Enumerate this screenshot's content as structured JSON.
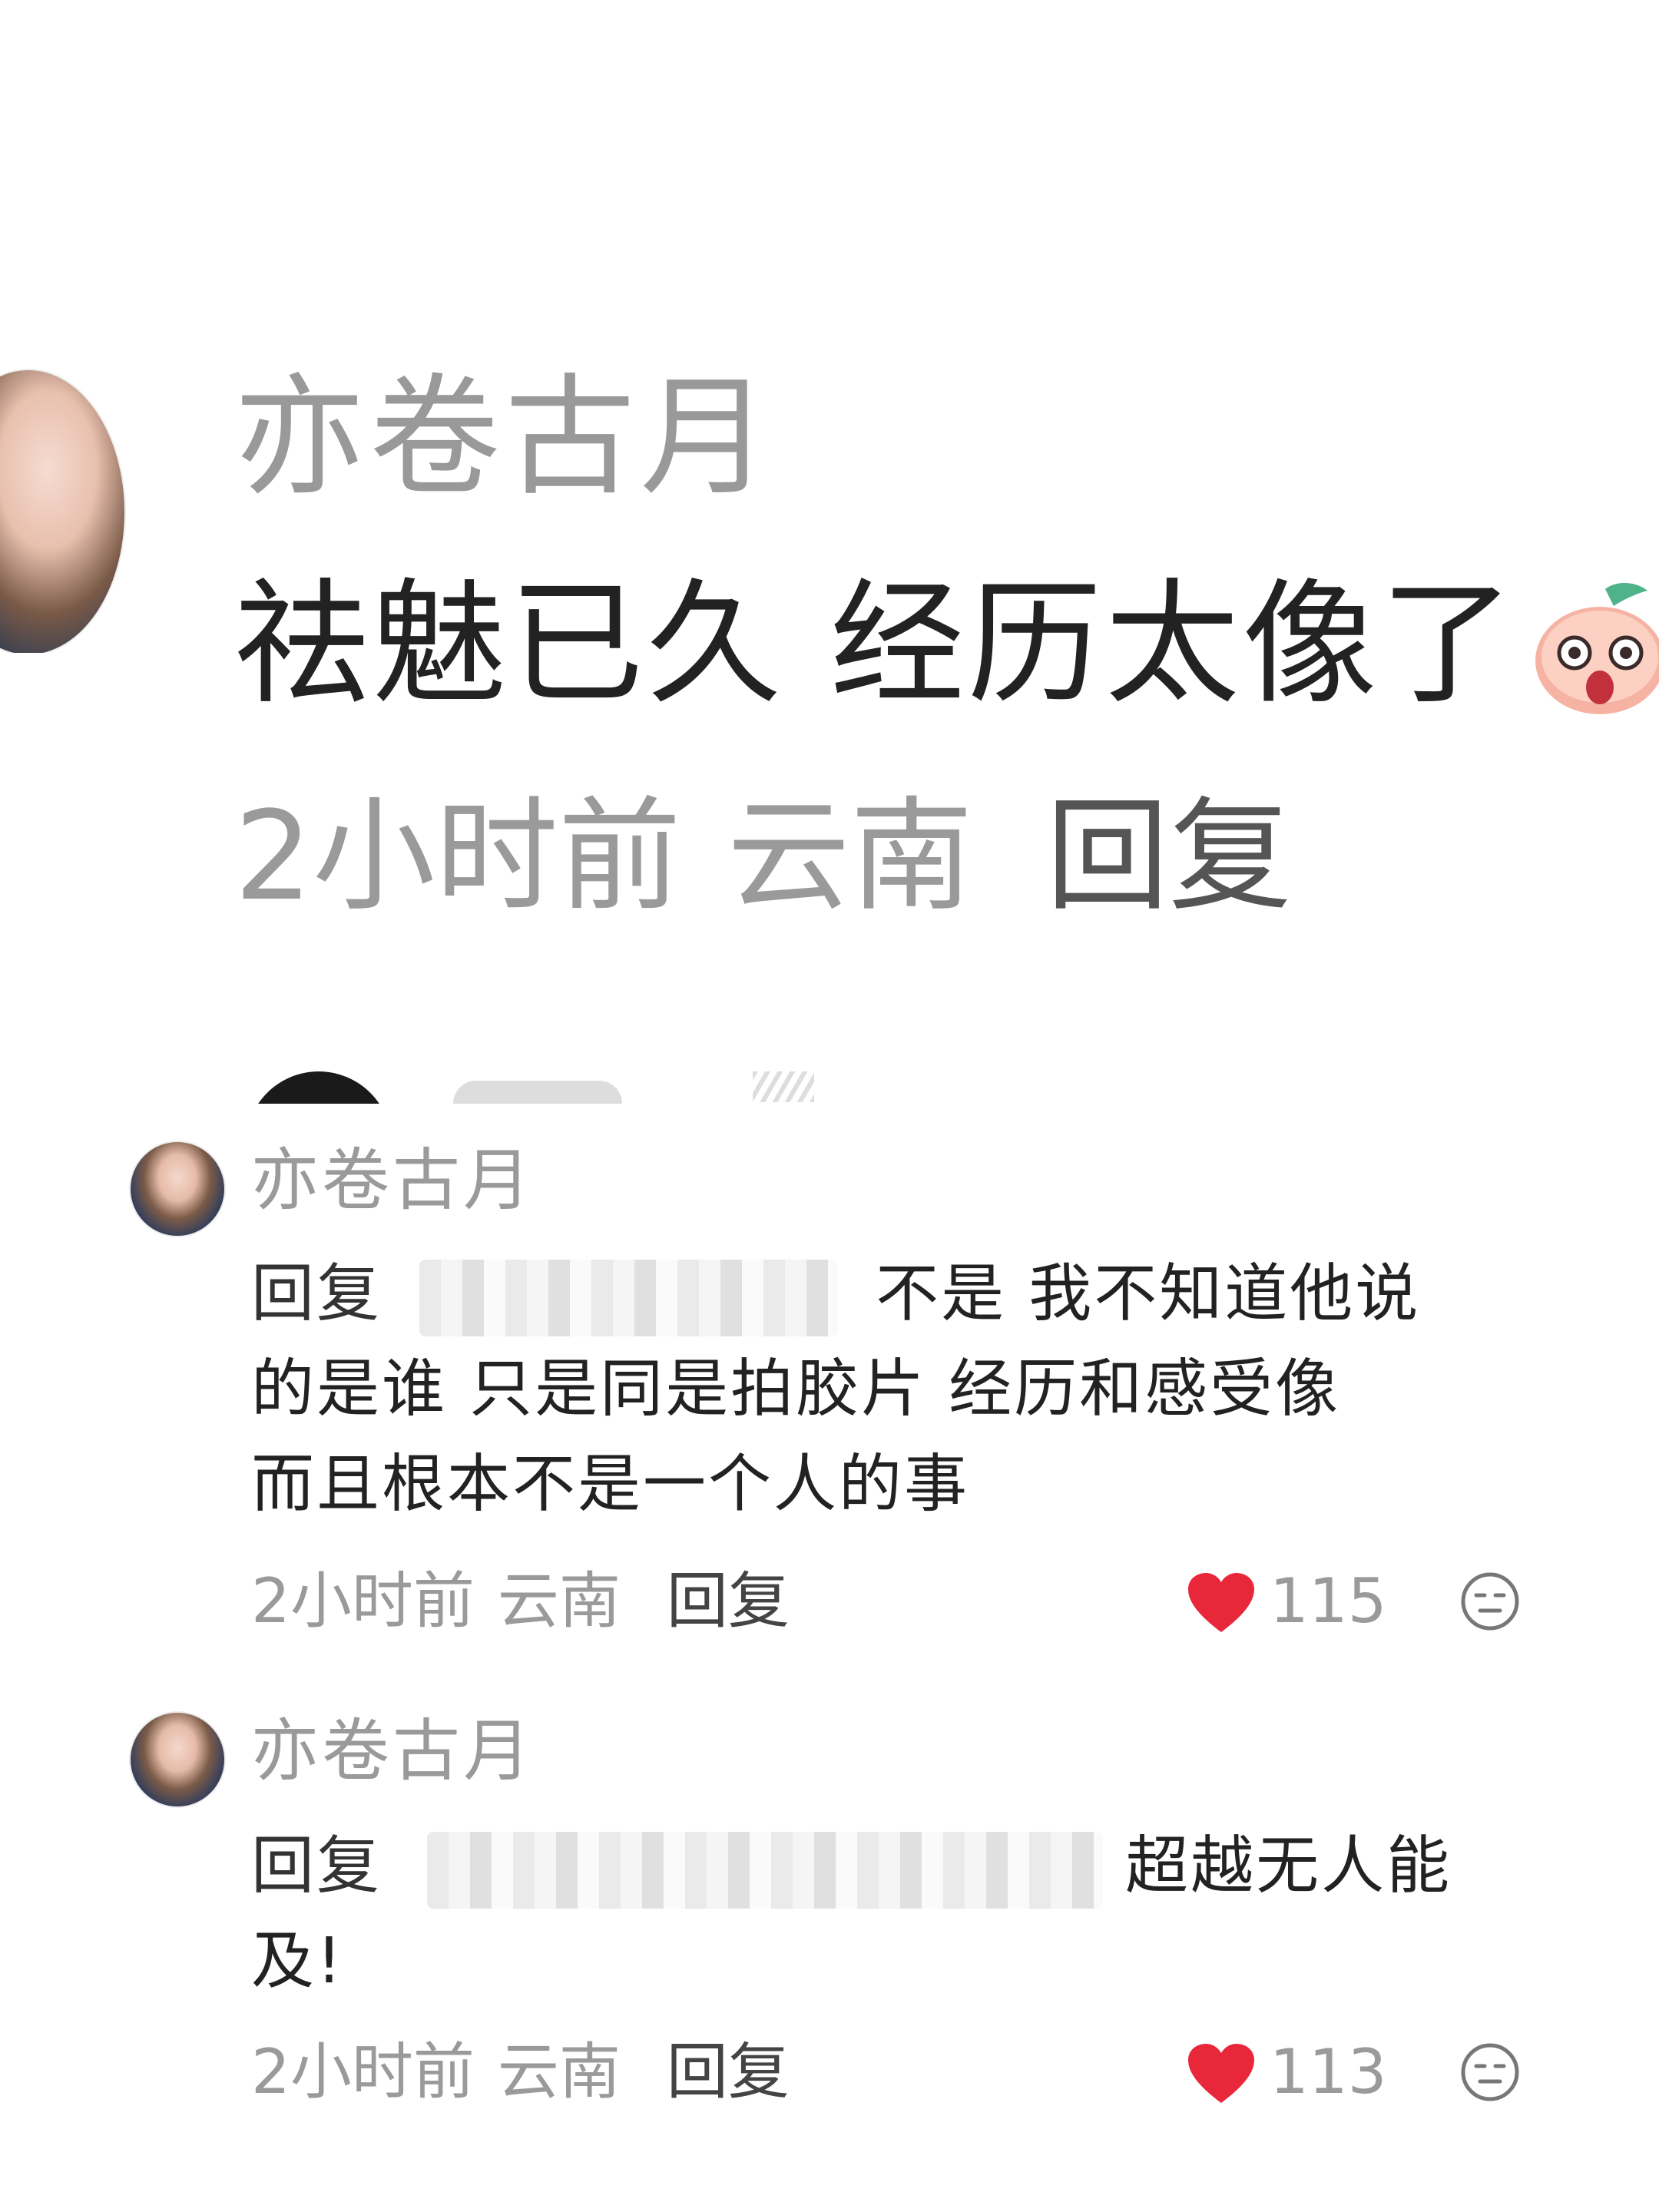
{
  "top_comment": {
    "username": "亦卷古月",
    "text": "祛魅已久 经历太像了",
    "time": "2小时前",
    "location": "云南",
    "reply_label": "回复",
    "emoji_icon": "peach-surprised-emoji"
  },
  "replies": [
    {
      "username": "亦卷古月",
      "reply_prefix": "回复",
      "text_line1": "不是 我不知道他说",
      "text_line2": "的是谁 只是同是拍胶片 经历和感受像",
      "text_line3": "而且根本不是一个人的事",
      "time": "2小时前",
      "location": "云南",
      "reply_label": "回复",
      "likes": "115"
    },
    {
      "username": "亦卷古月",
      "reply_prefix": "回复",
      "text_line1": "超越无人能",
      "text_line2": "及!",
      "time": "2小时前",
      "location": "云南",
      "reply_label": "回复",
      "likes": "113"
    }
  ],
  "colors": {
    "like_heart": "#e8283a",
    "meta_gray": "#9a9a9a",
    "text_dark": "#222222"
  }
}
